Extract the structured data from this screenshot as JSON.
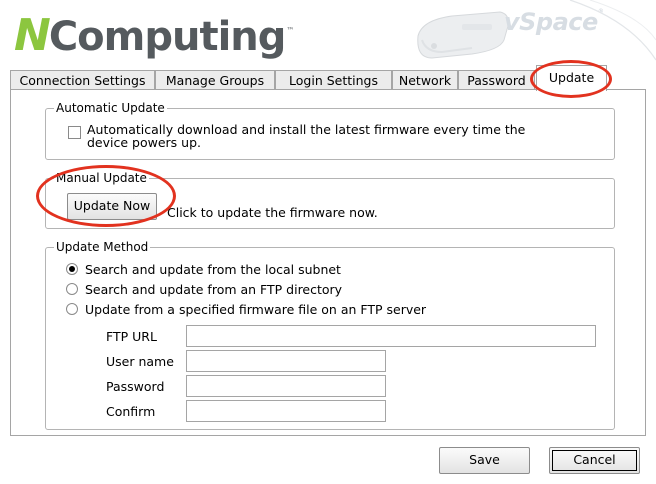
{
  "header": {
    "logo_letter": "N",
    "logo_rest": "Computing",
    "logo_tm": "™",
    "product_name": "vSpace",
    "product_mark": "®"
  },
  "tabs": [
    {
      "label": "Connection Settings"
    },
    {
      "label": "Manage Groups"
    },
    {
      "label": "Login Settings"
    },
    {
      "label": "Network"
    },
    {
      "label": "Password"
    },
    {
      "label": "Update",
      "active": true
    }
  ],
  "automatic_update": {
    "legend": "Automatic Update",
    "checkbox_label": "Automatically download and install the latest firmware every time the device powers up.",
    "checked": false
  },
  "manual_update": {
    "legend": "Manual Update",
    "button_label": "Update Now",
    "hint": "Click to update the firmware now."
  },
  "update_method": {
    "legend": "Update Method",
    "options": [
      {
        "label": "Search and update from the local subnet",
        "selected": true
      },
      {
        "label": "Search and update from an FTP directory",
        "selected": false
      },
      {
        "label": "Update from a specified firmware file on an FTP server",
        "selected": false
      }
    ],
    "fields": {
      "ftp_url": {
        "label": "FTP URL",
        "value": ""
      },
      "user_name": {
        "label": "User name",
        "value": ""
      },
      "password": {
        "label": "Password",
        "value": ""
      },
      "confirm": {
        "label": "Confirm",
        "value": ""
      }
    }
  },
  "footer": {
    "save_label": "Save",
    "cancel_label": "Cancel"
  },
  "annotation_color": "#e2321f",
  "brand_colors": {
    "green": "#8cc63f",
    "gray": "#555a5e"
  }
}
